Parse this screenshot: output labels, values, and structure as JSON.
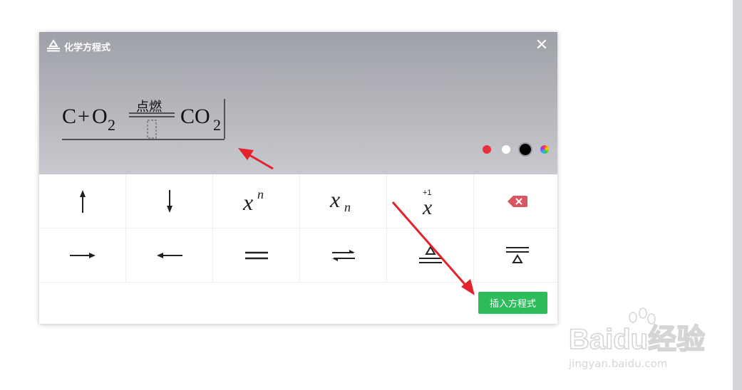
{
  "dialog": {
    "title": "化学方程式",
    "close_label": "✕",
    "formula": {
      "parts": [
        "C",
        "+",
        "O",
        "2",
        "CO",
        "2"
      ],
      "condition": "点燃"
    },
    "color_swatches": [
      {
        "name": "red",
        "color": "#e8303a",
        "selected": false
      },
      {
        "name": "white",
        "color": "#ffffff",
        "selected": false
      },
      {
        "name": "black",
        "color": "#000000",
        "selected": true
      },
      {
        "name": "rainbow",
        "color": "conic",
        "selected": false
      }
    ],
    "keypad": {
      "row1": [
        "up-arrow",
        "down-arrow",
        "superscript-n",
        "subscript-n",
        "charge-plus1",
        "backspace"
      ],
      "row2": [
        "right-arrow",
        "left-arrow",
        "equals",
        "reversible",
        "heat-below",
        "heat-above"
      ],
      "superscript_base": "x",
      "superscript_exp": "n",
      "subscript_base": "x",
      "subscript_sub": "n",
      "charge_base": "x",
      "charge_label": "+1"
    },
    "insert_button_label": "插入方程式"
  },
  "watermark": {
    "brand": "Baidu经验",
    "url": "jingyan.baidu.com"
  }
}
